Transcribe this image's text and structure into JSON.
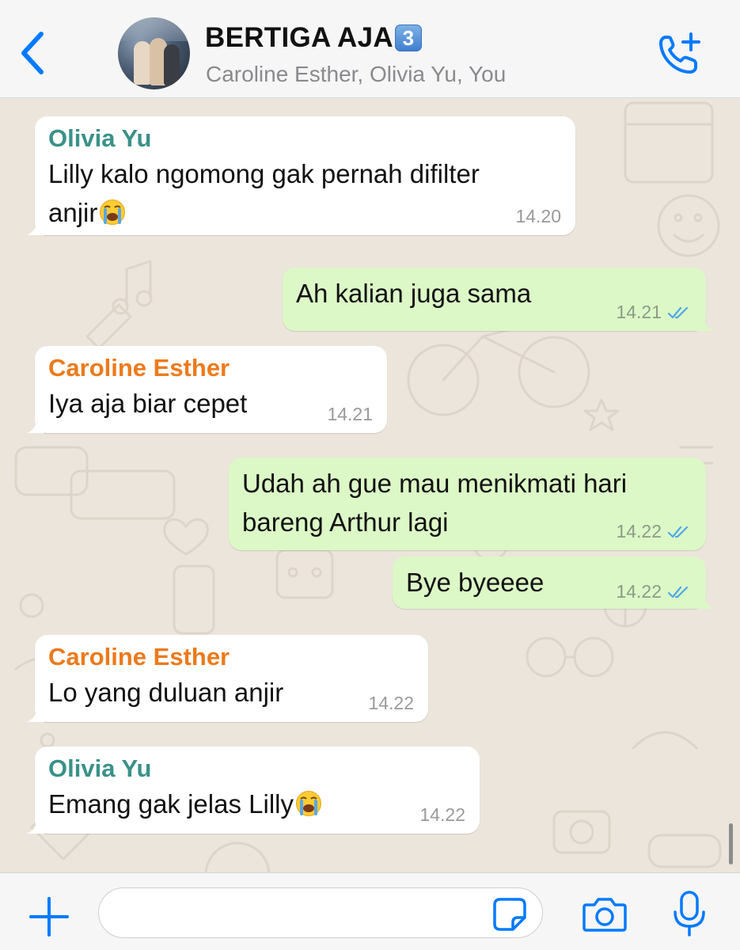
{
  "header": {
    "group_name": "BERTIGA AJA",
    "group_badge": "3",
    "members": "Caroline Esther, Olivia Yu, You"
  },
  "colors": {
    "accent": "#007aff",
    "outgoing_bubble": "#dcf8c6",
    "incoming_bubble": "#ffffff",
    "olivia_name": "#3a9188",
    "caroline_name": "#ec7a1c",
    "read_ticks": "#4fa8e8",
    "wallpaper": "#ece5dc"
  },
  "messages": [
    {
      "direction": "in",
      "sender": "Olivia Yu",
      "sender_color": "#3a9188",
      "lines": [
        "Lilly kalo ngomong gak pernah difilter",
        "anjir"
      ],
      "emoji": "loudly-crying-face",
      "time": "14.20"
    },
    {
      "direction": "out",
      "lines": [
        "Ah kalian juga sama"
      ],
      "time": "14.21",
      "status": "read-double-check"
    },
    {
      "direction": "in",
      "sender": "Caroline Esther",
      "sender_color": "#ec7a1c",
      "lines": [
        "Iya aja biar cepet"
      ],
      "time": "14.21"
    },
    {
      "direction": "out",
      "lines": [
        "Udah ah gue mau menikmati hari",
        "bareng Arthur lagi"
      ],
      "time": "14.22",
      "status": "read-double-check"
    },
    {
      "direction": "out",
      "lines": [
        "Bye byeeee"
      ],
      "time": "14.22",
      "status": "read-double-check"
    },
    {
      "direction": "in",
      "sender": "Caroline Esther",
      "sender_color": "#ec7a1c",
      "lines": [
        "Lo yang duluan anjir"
      ],
      "time": "14.22"
    },
    {
      "direction": "in",
      "sender": "Olivia Yu",
      "sender_color": "#3a9188",
      "lines": [
        "Emang gak jelas Lilly"
      ],
      "emoji": "loudly-crying-face",
      "time": "14.22"
    }
  ],
  "input": {
    "value": "",
    "placeholder": ""
  },
  "icons": {
    "back": "chevron-left-icon",
    "call": "phone-plus-icon",
    "attach": "plus-icon",
    "sticker": "sticker-icon",
    "camera": "camera-icon",
    "mic": "microphone-icon"
  }
}
